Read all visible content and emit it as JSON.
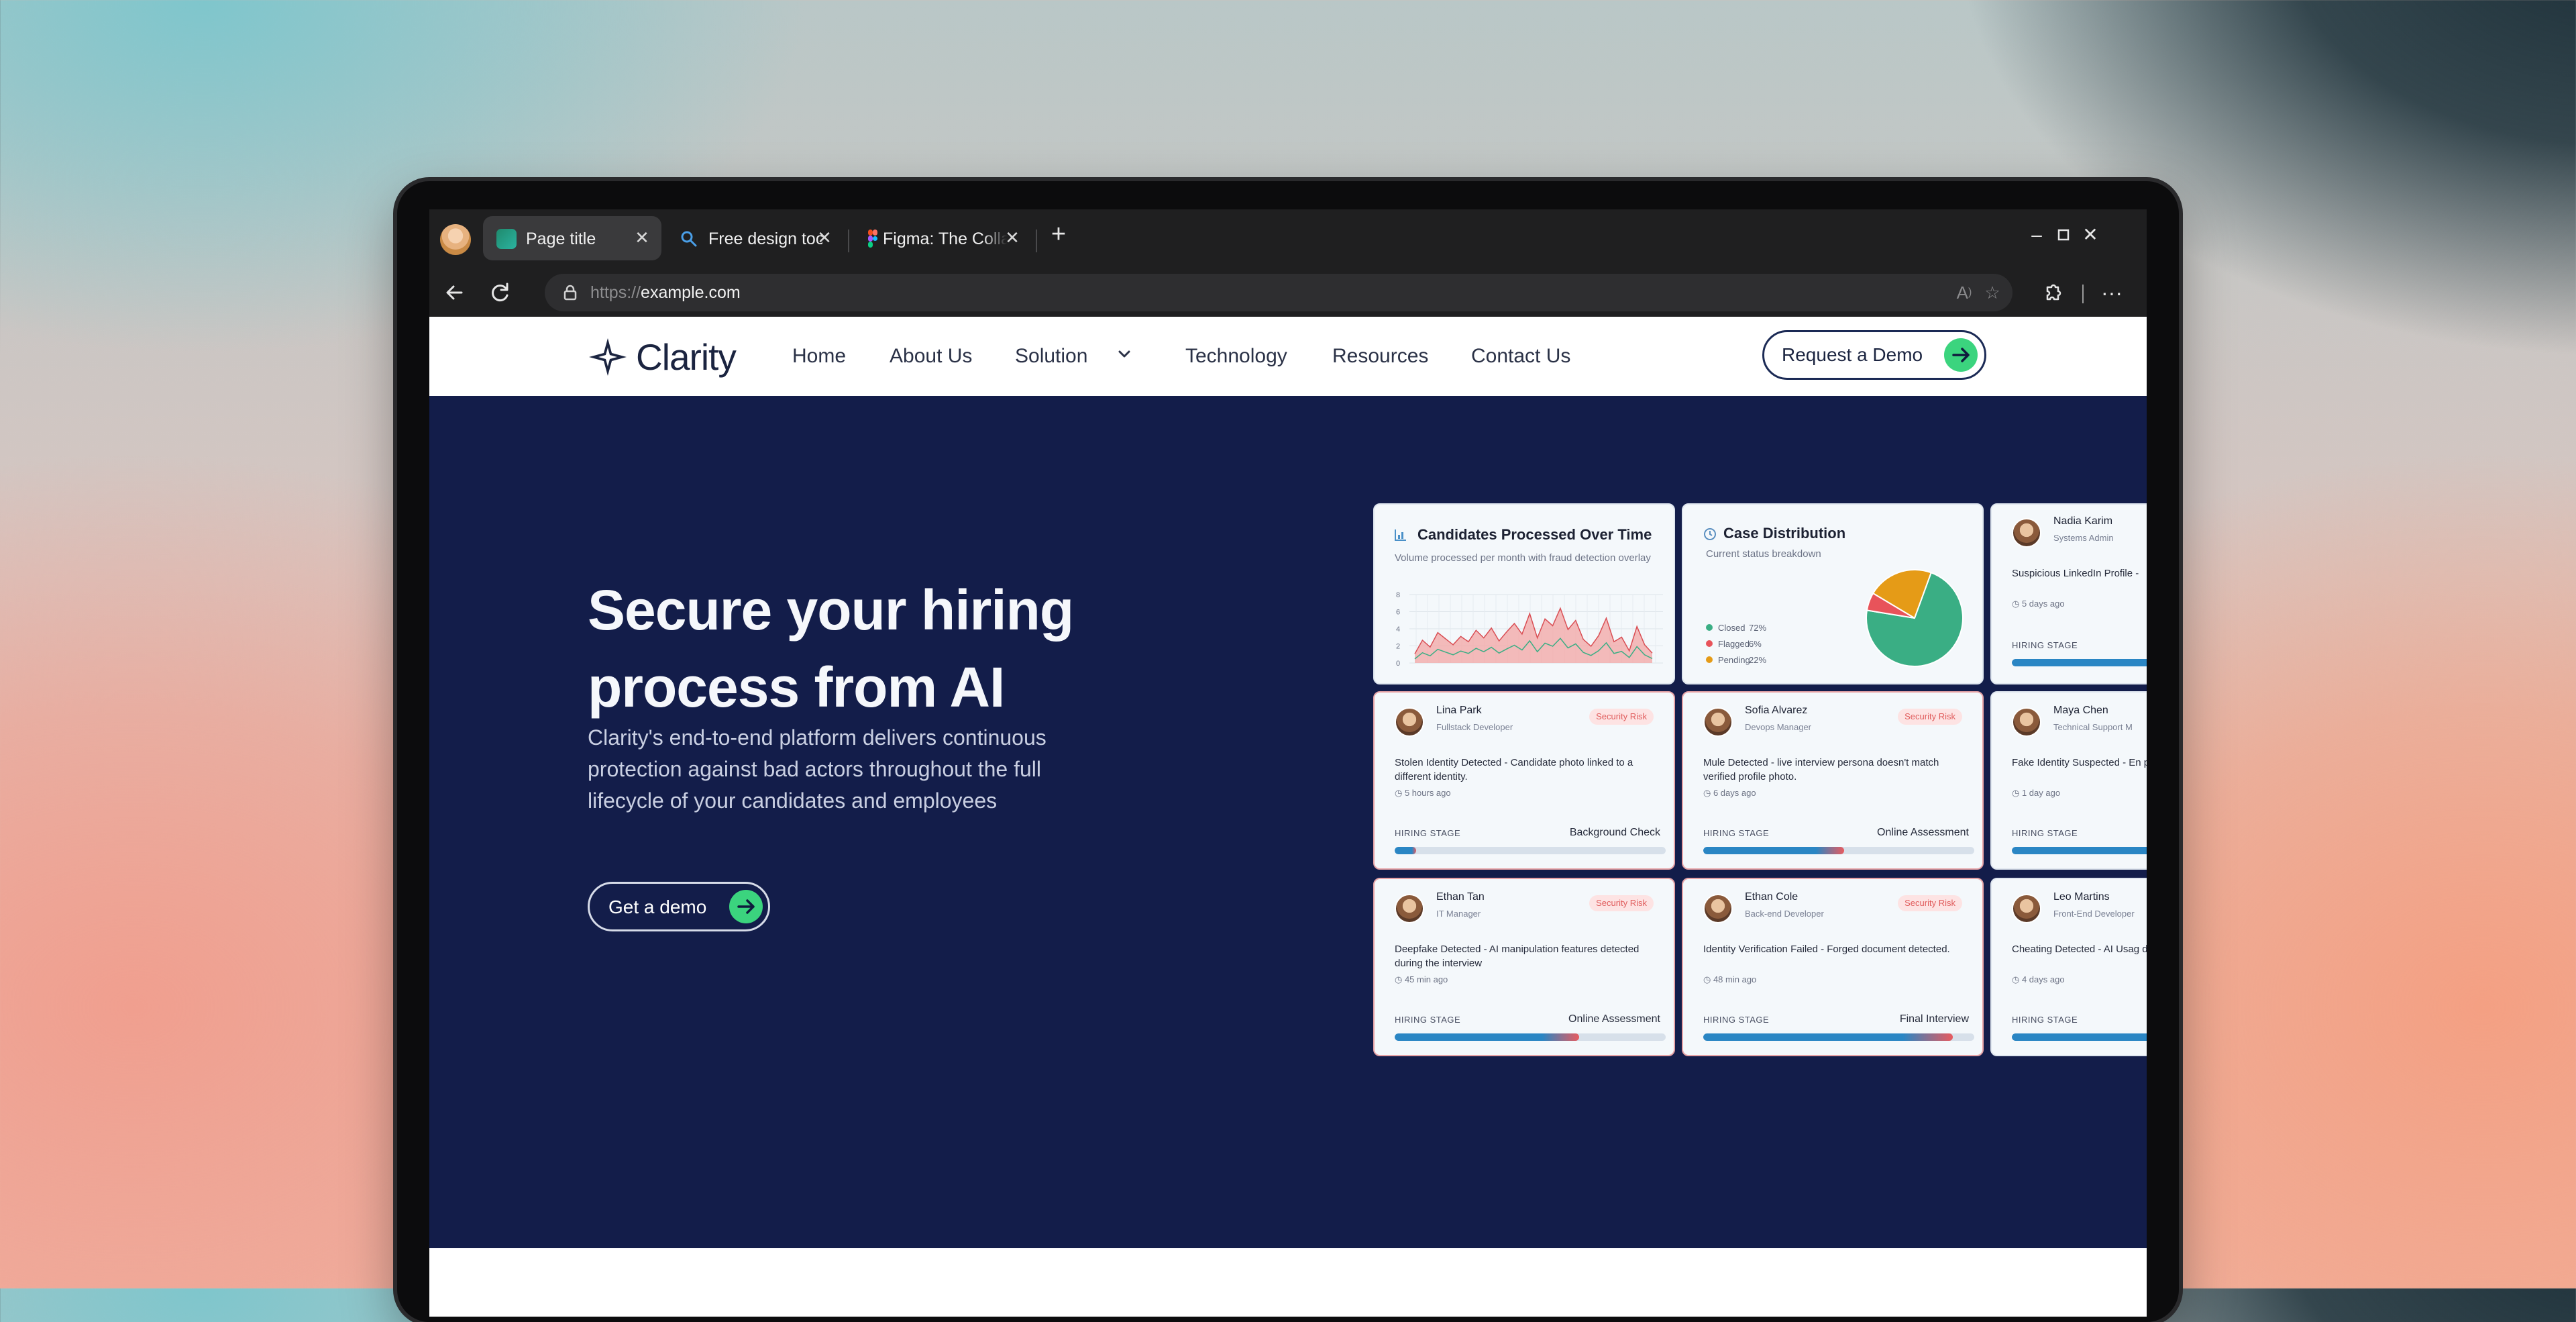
{
  "browser": {
    "tabs": [
      {
        "title": "Page title",
        "active": true
      },
      {
        "title": "Free design tool",
        "active": false
      },
      {
        "title": "Figma: The Collaborative",
        "active": false
      }
    ],
    "address": {
      "scheme": "https://",
      "host": "example.com"
    }
  },
  "site": {
    "brand": "Clarity",
    "nav": [
      "Home",
      "About Us",
      "Solution",
      "Technology",
      "Resources",
      "Contact Us"
    ],
    "cta": "Request a Demo",
    "hero": {
      "title": "Secure your hiring process from AI",
      "subtitle": "Clarity's end-to-end platform delivers continuous protection against bad actors throughout the full lifecycle of your candidates and employees",
      "button": "Get a demo"
    }
  },
  "widgets": {
    "line_chart": {
      "title": "Candidates Processed Over Time",
      "subtitle": "Volume processed per month with fraud detection overlay",
      "y_ticks": [
        "8",
        "6",
        "4",
        "2",
        "0"
      ],
      "ylim": [
        0,
        9
      ]
    },
    "pie_chart": {
      "title": "Case Distribution",
      "subtitle": "Current status breakdown",
      "legend": [
        {
          "label": "Closed",
          "value": "72%"
        },
        {
          "label": "Flagged",
          "value": "6%"
        },
        {
          "label": "Pending",
          "value": "22%"
        }
      ]
    },
    "stage_label": "HIRING STAGE",
    "risk_label": "Security Risk",
    "candidates": [
      {
        "name": "Nadia Karim",
        "role": "Systems Admin",
        "desc": "Suspicious LinkedIn Profile - ",
        "time": "5 days ago",
        "stage": "",
        "progress": 0.95,
        "risk": false
      },
      {
        "name": "Lina Park",
        "role": "Fullstack Developer",
        "desc": "Stolen Identity Detected - Candidate photo linked to a different identity.",
        "time": "5 hours ago",
        "stage": "Background Check",
        "progress": 0.08,
        "risk": true
      },
      {
        "name": "Sofia Alvarez",
        "role": "Devops Manager",
        "desc": "Mule Detected - live interview persona doesn't match verified profile photo.",
        "time": "6 days ago",
        "stage": "Online Assessment",
        "progress": 0.52,
        "risk": true
      },
      {
        "name": "Maya Chen",
        "role": "Technical Support M",
        "desc": "Fake Identity Suspected - En phone number in inactive.",
        "time": "1 day ago",
        "stage": "",
        "progress": 0.95,
        "risk": false
      },
      {
        "name": "Ethan Tan",
        "role": "IT Manager",
        "desc": "Deepfake Detected - AI manipulation features detected during the interview",
        "time": "45 min ago",
        "stage": "Online Assessment",
        "progress": 0.68,
        "risk": true
      },
      {
        "name": "Ethan Cole",
        "role": "Back-end Developer",
        "desc": "Identity Verification Failed - Forged document detected.",
        "time": "48 min ago",
        "stage": "Final Interview",
        "progress": 0.92,
        "risk": true
      },
      {
        "name": "Leo Martins",
        "role": "Front-End Developer",
        "desc": "Cheating Detected - AI Usag detected.",
        "time": "4 days ago",
        "stage": "",
        "progress": 0.95,
        "risk": false
      }
    ]
  },
  "colors": {
    "hero_bg": "#131d4a",
    "accent_green": "#3bd47e",
    "risk_red": "#e05c5c",
    "progress_blue": "#2a86c4",
    "pie_closed": "#3aae84",
    "pie_flagged": "#e8535a",
    "pie_pending": "#e59b17"
  },
  "icons": [
    "back-arrow-icon",
    "refresh-icon",
    "lock-icon",
    "read-aloud-icon",
    "star-icon",
    "extensions-icon",
    "more-icon",
    "close-icon",
    "plus-icon",
    "minimize-icon",
    "maximize-icon",
    "chevron-down-icon",
    "arrow-right-icon",
    "clock-icon",
    "chart-icon"
  ]
}
